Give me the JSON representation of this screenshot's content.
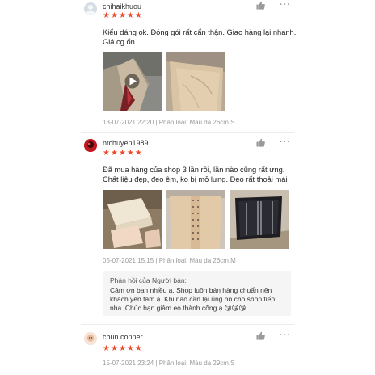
{
  "reviews": [
    {
      "username": "chihaikhuou",
      "stars": [
        "★",
        "★",
        "★",
        "★",
        "★"
      ],
      "text": "Kiểu dáng ok. Đóng gói rất cẩn thận. Giao hàng lại nhanh. Giá cg ổn",
      "meta": "13-07-2021 22:20 | Phân loại: Màu da 26cm,S",
      "more": "···"
    },
    {
      "username": "ntchuyen1989",
      "stars": [
        "★",
        "★",
        "★",
        "★",
        "★"
      ],
      "text": "Đã mua hàng của shop 3 lần rồi, lần nào cũng rất ưng. Chất liệu đẹp, đeo êm, ko bị mỏ lưng. Đeo rất thoải mái",
      "meta": "05-07-2021 15:15 | Phân loại: Màu da 26cm,M",
      "more": "···",
      "reply_title": "Phản hồi của Người bán:",
      "reply_text": "Cảm ơn bạn nhiều ạ. Shop luôn bán hàng chuẩn nên khách yên tâm ạ. Khi nào cần lại ủng hộ cho shop tiếp nha. Chúc bạn giảm eo thành công ạ 😘😘😘"
    },
    {
      "username": "chun.conner",
      "stars": [
        "★",
        "★",
        "★",
        "★",
        "★"
      ],
      "meta": "15-07-2021 23:24 | Phân loại: Màu da 29cm,S",
      "more": "···"
    }
  ],
  "colors": {
    "star": "#ee4d2d",
    "meta": "#9b9b9b",
    "reply_bg": "#f5f5f5"
  },
  "icons": [
    "user-avatar-icon",
    "thumbs-up-icon",
    "more-options-icon",
    "play-icon"
  ]
}
